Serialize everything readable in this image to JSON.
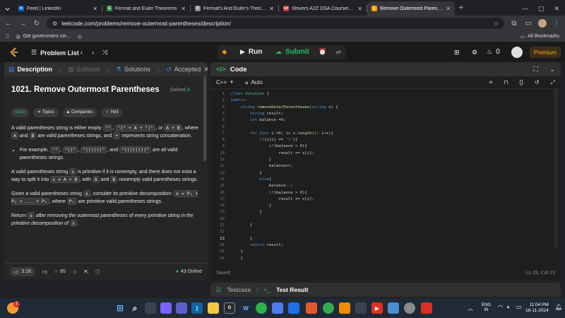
{
  "browser": {
    "tabs": [
      {
        "title": "Feed | LinkedIn",
        "favicon": "in",
        "color": "#0a66c2",
        "active": false
      },
      {
        "title": "Fermat and Euler Theorems",
        "favicon": "G",
        "color": "#2f8d46",
        "active": false
      },
      {
        "title": "Fermat's And Euler's Theorems",
        "favicon": "B",
        "color": "#888888",
        "active": false
      },
      {
        "title": "Strivers A2Z DSA Course/Sheet",
        "favicon": "tuf",
        "color": "#d1343a",
        "active": false
      },
      {
        "title": "Remove Outermost Parenthese",
        "favicon": "L",
        "color": "#ffa116",
        "active": true
      }
    ],
    "address": "leetcode.com/problems/remove-outermost-parentheses/description/",
    "bookmarks": [
      {
        "label": "Get government cer..."
      }
    ],
    "all_bookmarks": "All Bookmarks"
  },
  "lc_header": {
    "problem_list": "Problem List",
    "run": "Run",
    "submit": "Submit",
    "streak": "0",
    "premium": "Premium"
  },
  "description": {
    "tabs": [
      "Description",
      "Editorial",
      "Solutions",
      "Accepted",
      "S"
    ],
    "title": "1021. Remove Outermost Parentheses",
    "solved": "Solved",
    "chips": [
      "Easy",
      "Topics",
      "Companies",
      "Hint"
    ],
    "p1a": "A valid parentheses string is either empty",
    "p1b": "where",
    "p1c": "and",
    "p1d": "are valid parentheses strings, and",
    "p1e": "represents string concatenation.",
    "p1_codes": [
      "\"\"",
      "\"(\" + A + \")\"",
      "A + B",
      "A",
      "B",
      "+"
    ],
    "bullet_pre": "For example,",
    "bullet_codes": [
      "\"\"",
      "\"()\"",
      "\"(())()\"",
      "\"(()(()))\""
    ],
    "bullet_post": "are all valid parentheses strings.",
    "p2a": "A valid parentheses string",
    "p2b": "is primitive if it is nonempty, and there does not exist a way to split it into",
    "p2c": ", with",
    "p2d": "and",
    "p2e": "nonempty valid parentheses strings.",
    "p2_codes": [
      "s",
      "s = A + B",
      "A",
      "B"
    ],
    "p3a": "Given a valid parentheses string",
    "p3b": ", consider its primitive decomposition:",
    "p3c": ", where",
    "p3d": "are primitive valid parentheses strings.",
    "p3_codes": [
      "s",
      "s = P₁ + P₂ + ... + Pₖ",
      "Pᵢ"
    ],
    "p4a": "Return",
    "p4b": "after removing the outermost parentheses of every primitive string in the primitive decomposition of",
    "p4_codes": [
      "s",
      "s"
    ],
    "likes": "3.1K",
    "comments": "65",
    "online": "43 Online"
  },
  "code": {
    "title": "Code",
    "language": "C++",
    "mode": "Auto",
    "lines": [
      "class Solution {",
      "public:",
      "    string removeOuterParentheses(string s) {",
      "        string result;",
      "        int balance =0;",
      "",
      "        for (int i =0; i< s.length(); i++){",
      "            if(s[i] == '('){",
      "                if(balance > 0){",
      "                    result += s[i];",
      "                }",
      "                balance++;",
      "            }",
      "            else{",
      "                balance--;",
      "                if(balance > 0){",
      "                    result += s[i];",
      "                }",
      "            }",
      "",
      "        }",
      "",
      "        }",
      "        return result;",
      "    }",
      "    }"
    ],
    "current_line": 23,
    "status": "Saved",
    "cursor": "Ln 23, Col 23"
  },
  "result_bar": {
    "testcase": "Testcase",
    "test_result": "Test Result"
  },
  "taskbar": {
    "weather_badge": "1",
    "lang": "ENG",
    "region": "IN",
    "time": "11:04 PM",
    "date": "18-11-2024"
  }
}
